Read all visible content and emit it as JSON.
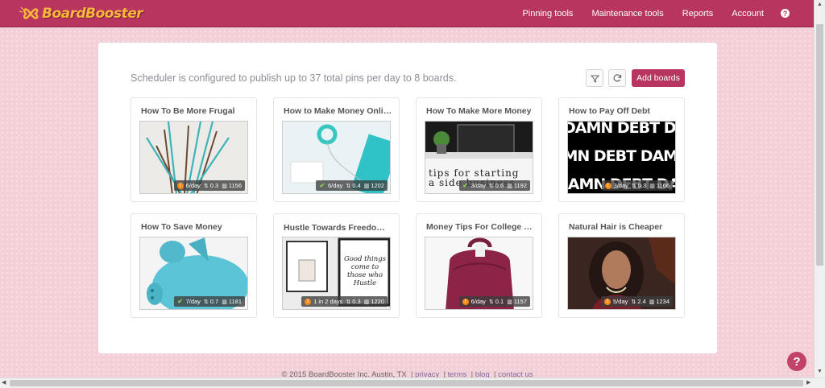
{
  "brand": {
    "name": "BoardBooster",
    "logo_icon": "ribbon-logo-icon"
  },
  "nav": {
    "items": [
      "Pinning tools",
      "Maintenance tools",
      "Reports",
      "Account"
    ],
    "help_label": "?"
  },
  "summary": {
    "text": "Scheduler is configured to publish up to 37 total pins per day to 8 boards."
  },
  "toolbar": {
    "filter_icon": "filter-icon",
    "refresh_icon": "refresh-icon",
    "add_label": "Add boards"
  },
  "boards": [
    {
      "title": "How To Be More Frugal",
      "status": "warn",
      "rate": "6/day",
      "score": "0.3",
      "pins": "1156",
      "art": "branches"
    },
    {
      "title": "How to Make Money Online",
      "status": "ok",
      "rate": "6/day",
      "score": "0.4",
      "pins": "1202",
      "art": "desk"
    },
    {
      "title": "How To Make More Money",
      "status": "ok",
      "rate": "3/day",
      "score": "0.6",
      "pins": "1192",
      "art": "computer"
    },
    {
      "title": "How to Pay Off Debt",
      "status": "warn",
      "rate": "3/day",
      "score": "0.3",
      "pins": "1166",
      "art": "debt"
    },
    {
      "title": "How To Save Money",
      "status": "ok",
      "rate": "7/day",
      "score": "0.7",
      "pins": "1181",
      "art": "piggy"
    },
    {
      "title": "Hustle Towards Freedom 👯",
      "status": "warn",
      "rate": "1 in 2 days",
      "score": "0.3",
      "pins": "1220",
      "art": "hustle"
    },
    {
      "title": "Money Tips For College St...",
      "status": "warn",
      "rate": "6/day",
      "score": "0.1",
      "pins": "1157",
      "art": "backpack"
    },
    {
      "title": "Natural Hair is Cheaper",
      "status": "warn",
      "rate": "5/day",
      "score": "2.4",
      "pins": "1234",
      "art": "portrait"
    }
  ],
  "art_text": {
    "computer": "tips for starting\na side business",
    "debt_line": "DAMN DEBT DAMN DEBT DAMN",
    "hustle": "Good things\ncome to\nthose who\nHustle"
  },
  "footer": {
    "copyright": "© 2015 BoardBooster Inc. Austin, TX",
    "links": [
      "privacy",
      "terms",
      "blog",
      "contact us"
    ]
  },
  "float_help": "?"
}
